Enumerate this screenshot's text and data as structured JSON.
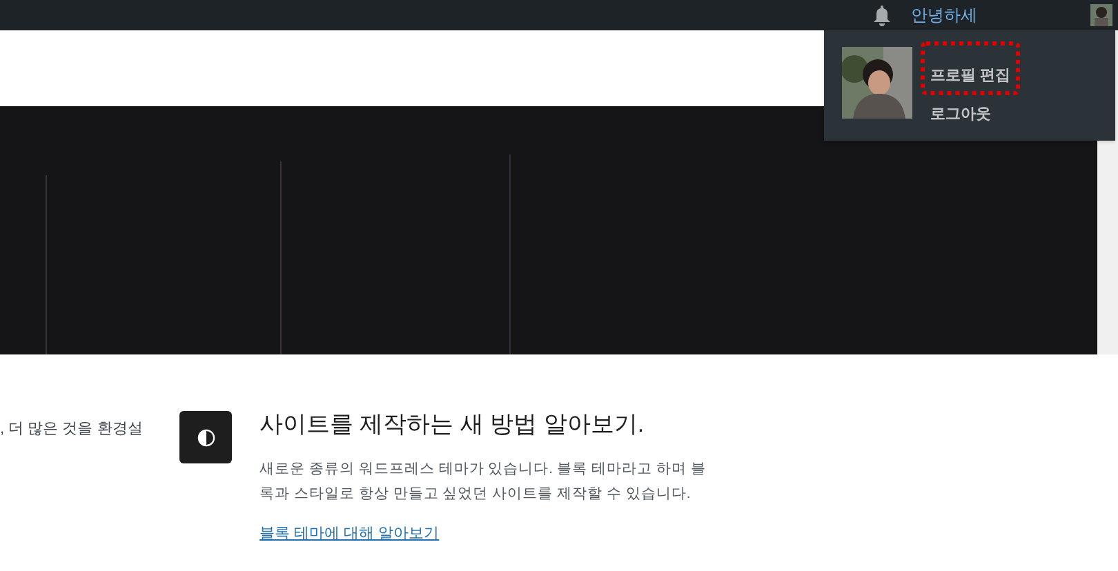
{
  "admin_bar": {
    "greeting": "안녕하세"
  },
  "account_menu": {
    "items": [
      {
        "label": "프로필 편집",
        "highlighted": true
      },
      {
        "label": "로그아웃",
        "highlighted": false
      }
    ]
  },
  "left_text": ", 더 많은 것을 환경설",
  "feature": {
    "title": "사이트를 제작하는 새 방법 알아보기.",
    "description": "새로운 종류의 워드프레스 테마가 있습니다. 블록 테마라고 하며 블록과 스타일로 항상 만들고 싶었던 사이트를 제작할 수 있습니다.",
    "link": "블록 테마에 대해 알아보기"
  }
}
